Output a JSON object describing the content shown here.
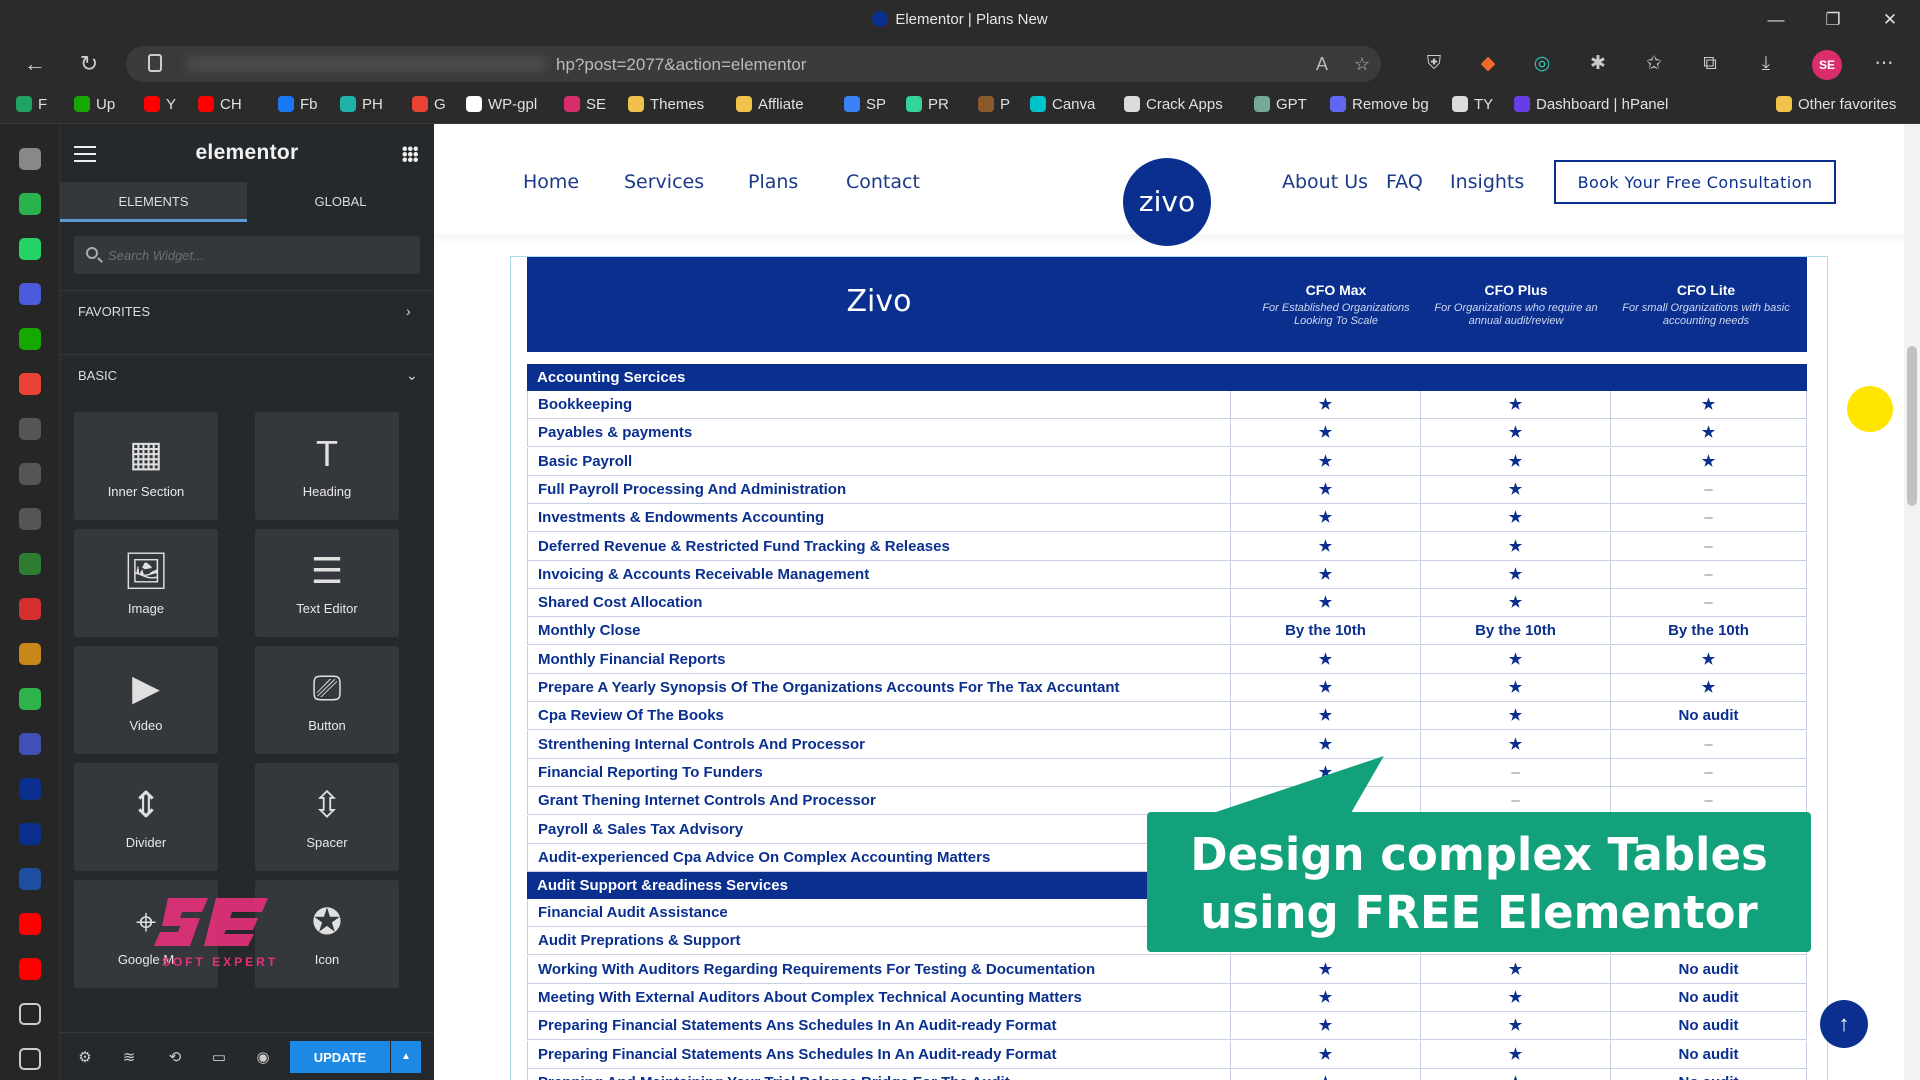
{
  "window": {
    "title": "Elementor | Plans New",
    "controls": [
      "—",
      "❐",
      "✕"
    ]
  },
  "address_bar": {
    "url": "hp?post=2077&action=elementor"
  },
  "bookmarks": [
    {
      "label": "F",
      "color": "#1fa463"
    },
    {
      "label": "Up",
      "color": "#14a800"
    },
    {
      "label": "Y",
      "color": "#ff0000"
    },
    {
      "label": "CH",
      "color": "#ff0000"
    },
    {
      "label": "Fb",
      "color": "#1877f2"
    },
    {
      "label": "PH",
      "color": "#20b2aa"
    },
    {
      "label": "G",
      "color": "#ea4335"
    },
    {
      "label": "WP-gpl",
      "color": "#ffffff"
    },
    {
      "label": "SE",
      "color": "#d92d6c"
    },
    {
      "label": "Themes",
      "color": "#f0c24b"
    },
    {
      "label": "Affliate",
      "color": "#f0c24b"
    },
    {
      "label": "SP",
      "color": "#3b82f6"
    },
    {
      "label": "PR",
      "color": "#34d399"
    },
    {
      "label": "P",
      "color": "#8b5a2b"
    },
    {
      "label": "Canva",
      "color": "#00c4cc"
    },
    {
      "label": "Crack Apps",
      "color": "#dddddd"
    },
    {
      "label": "GPT",
      "color": "#74aa9c"
    },
    {
      "label": "Remove bg",
      "color": "#6366f1"
    },
    {
      "label": "TY",
      "color": "#dddddd"
    },
    {
      "label": "Dashboard | hPanel",
      "color": "#673de6"
    },
    {
      "label": "Other favorites",
      "color": "#f0c24b"
    }
  ],
  "rail": [
    {
      "icon": "tabs-icon",
      "color": "#888888"
    },
    {
      "icon": "feedly-icon",
      "color": "#2bb24c"
    },
    {
      "icon": "whatsapp-icon",
      "color": "#25d366"
    },
    {
      "icon": "moon-icon",
      "color": "#4b5bdc"
    },
    {
      "icon": "upwork-icon",
      "color": "#14a800"
    },
    {
      "icon": "gmail-icon",
      "color": "#ea4335"
    },
    {
      "icon": "tab-icon",
      "color": "#555555"
    },
    {
      "icon": "tab-icon",
      "color": "#555555"
    },
    {
      "icon": "tab-icon",
      "color": "#555555"
    },
    {
      "icon": "leaf-icon",
      "color": "#2e7d32"
    },
    {
      "icon": "record-icon",
      "color": "#d32f2f"
    },
    {
      "icon": "trophy-icon",
      "color": "#c88719"
    },
    {
      "icon": "sheet-icon",
      "color": "#2fb34a"
    },
    {
      "icon": "list-icon",
      "color": "#3f51b5"
    },
    {
      "icon": "zivo-icon",
      "color": "#0a2f8f"
    },
    {
      "icon": "zivo-icon",
      "color": "#0a2f8f"
    },
    {
      "icon": "c-icon",
      "color": "#1c4fa1"
    },
    {
      "icon": "youtube-icon",
      "color": "#ff0000"
    },
    {
      "icon": "youtube-icon",
      "color": "#ff0000"
    },
    {
      "icon": "doc-icon",
      "color": "#cccccc"
    },
    {
      "icon": "plus-icon",
      "color": "#cccccc"
    }
  ],
  "panel": {
    "logo": "elementor",
    "tabs": [
      "ELEMENTS",
      "GLOBAL"
    ],
    "search_placeholder": "Search Widget...",
    "favorites_label": "FAVORITES",
    "basic_label": "BASIC",
    "widgets": [
      {
        "label": "Inner Section",
        "icon": "columns-icon",
        "glyph": "▦"
      },
      {
        "label": "Heading",
        "icon": "heading-icon",
        "glyph": "T"
      },
      {
        "label": "Image",
        "icon": "image-icon",
        "glyph": "🖼"
      },
      {
        "label": "Text Editor",
        "icon": "text-editor-icon",
        "glyph": "☰"
      },
      {
        "label": "Video",
        "icon": "video-icon",
        "glyph": "▶"
      },
      {
        "label": "Button",
        "icon": "button-icon",
        "glyph": "⎚"
      },
      {
        "label": "Divider",
        "icon": "divider-icon",
        "glyph": "⇕"
      },
      {
        "label": "Spacer",
        "icon": "spacer-icon",
        "glyph": "⇳"
      },
      {
        "label": "Google M",
        "icon": "map-icon",
        "glyph": "⌖"
      },
      {
        "label": "Icon",
        "icon": "star-circle-icon",
        "glyph": "✪"
      }
    ],
    "update_label": "UPDATE",
    "watermark": "SOFT EXPERT"
  },
  "site": {
    "nav_left": [
      "Home",
      "Services",
      "Plans",
      "Contact"
    ],
    "brand": "zivo",
    "nav_right": [
      "About Us",
      "FAQ",
      "Insights"
    ],
    "cta": "Book Your Free Consultation"
  },
  "table": {
    "brand": "Zivo",
    "plans": [
      {
        "name": "CFO Max",
        "desc": "For Established Organizations Looking To Scale"
      },
      {
        "name": "CFO Plus",
        "desc": "For Organizations who require an annual audit/review"
      },
      {
        "name": "CFO Lite",
        "desc": "For small Organizations with basic accounting needs"
      }
    ],
    "sections": [
      {
        "title": "Accounting Sercices",
        "rows": [
          {
            "label": "Bookkeeping",
            "values": [
              "★",
              "★",
              "★"
            ]
          },
          {
            "label": "Payables & payments",
            "values": [
              "★",
              "★",
              "★"
            ]
          },
          {
            "label": "Basic Payroll",
            "values": [
              "★",
              "★",
              "★"
            ]
          },
          {
            "label": "Full Payroll Processing And Administration",
            "values": [
              "★",
              "★",
              "–"
            ]
          },
          {
            "label": "Investments & Endowments Accounting",
            "values": [
              "★",
              "★",
              "–"
            ]
          },
          {
            "label": "Deferred Revenue & Restricted Fund Tracking & Releases",
            "values": [
              "★",
              "★",
              "–"
            ]
          },
          {
            "label": "Invoicing & Accounts Receivable Management",
            "values": [
              "★",
              "★",
              "–"
            ]
          },
          {
            "label": "Shared Cost Allocation",
            "values": [
              "★",
              "★",
              "–"
            ]
          },
          {
            "label": "Monthly Close",
            "values": [
              "By the 10th",
              "By the 10th",
              "By the 10th"
            ]
          },
          {
            "label": "Monthly Financial Reports",
            "values": [
              "★",
              "★",
              "★"
            ]
          },
          {
            "label": "Prepare A Yearly Synopsis Of The Organizations Accounts For The Tax Accuntant",
            "values": [
              "★",
              "★",
              "★"
            ]
          },
          {
            "label": "Cpa Review Of The Books",
            "values": [
              "★",
              "★",
              "No audit"
            ]
          },
          {
            "label": "Strenthening Internal Controls And Processor",
            "values": [
              "★",
              "★",
              "–"
            ]
          },
          {
            "label": "Financial Reporting To Funders",
            "values": [
              "★",
              "–",
              "–"
            ]
          },
          {
            "label": "Grant Thening Internet Controls And Processor",
            "values": [
              "★",
              "–",
              "–"
            ]
          },
          {
            "label": "Payroll & Sales Tax Advisory",
            "values": [
              "",
              "",
              ""
            ]
          },
          {
            "label": "Audit-experienced Cpa Advice On Complex Accounting Matters",
            "values": [
              "",
              "",
              ""
            ]
          }
        ]
      },
      {
        "title": "Audit Support &readiness Services",
        "rows": [
          {
            "label": "Financial Audit Assistance",
            "values": [
              "",
              "",
              ""
            ]
          },
          {
            "label": "Audit Preprations & Support",
            "values": [
              "",
              "",
              ""
            ]
          },
          {
            "label": "Working With Auditors Regarding Requirements For Testing & Documentation",
            "values": [
              "★",
              "★",
              "No audit"
            ]
          },
          {
            "label": "Meeting With External Auditors About Complex Technical Aocunting Matters",
            "values": [
              "★",
              "★",
              "No audit"
            ]
          },
          {
            "label": "Preparing Financial Statements Ans Schedules In An Audit-ready Format",
            "values": [
              "★",
              "★",
              "No audit"
            ]
          },
          {
            "label": "Preparing Financial Statements Ans Schedules In An Audit-ready Format",
            "values": [
              "★",
              "★",
              "No audit"
            ]
          },
          {
            "label": "Prepping And Maintaining Your Trial Balance Bridge For The Audit",
            "values": [
              "★",
              "★",
              "No audit"
            ]
          }
        ]
      }
    ]
  },
  "callout": {
    "line1": "Design complex Tables",
    "line2": "using FREE Elementor"
  },
  "to_top_glyph": "↑"
}
